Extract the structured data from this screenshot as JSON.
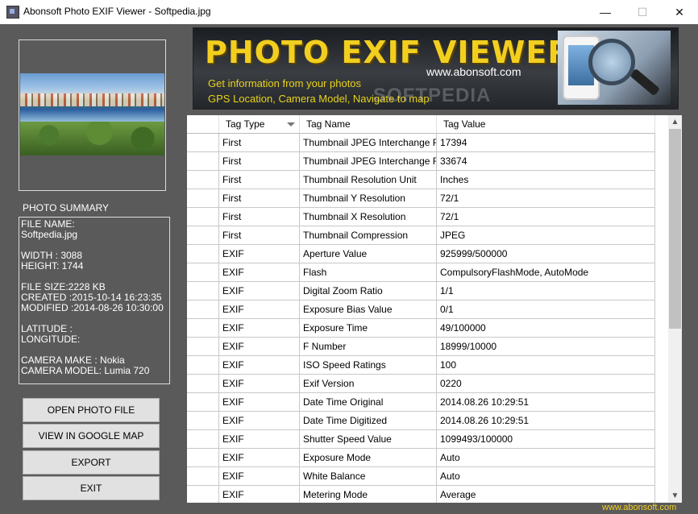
{
  "window": {
    "title": "Abonsoft Photo EXIF Viewer - Softpedia.jpg",
    "min": "—",
    "max": "☐",
    "close": "✕"
  },
  "banner": {
    "title": "PHOTO EXIF VIEWER",
    "url": "www.abonsoft.com",
    "line1": "Get information from your photos",
    "line2": "GPS Location, Camera Model, Navigate to map",
    "watermark": "SOFTPEDIA"
  },
  "summary": {
    "heading": "PHOTO SUMMARY",
    "lines": [
      "FILE NAME:",
      "Softpedia.jpg",
      "",
      "WIDTH : 3088",
      "HEIGHT: 1744",
      "",
      "FILE SIZE:2228 KB",
      "CREATED  :2015-10-14 16:23:35",
      "MODIFIED :2014-08-26 10:30:00",
      "",
      "LATITUDE :",
      "LONGITUDE:",
      "",
      "CAMERA MAKE : Nokia",
      "CAMERA MODEL: Lumia 720"
    ]
  },
  "buttons": {
    "open": "OPEN PHOTO FILE",
    "map": "VIEW IN GOOGLE MAP",
    "export": "EXPORT",
    "exit": "EXIT"
  },
  "table": {
    "headers": [
      "Tag Type",
      "Tag Name",
      "Tag Value"
    ],
    "rows": [
      [
        "First",
        "Thumbnail JPEG Interchange F...",
        "17394"
      ],
      [
        "First",
        "Thumbnail JPEG Interchange F...",
        "33674"
      ],
      [
        "First",
        "Thumbnail Resolution Unit",
        "Inches"
      ],
      [
        "First",
        "Thumbnail Y Resolution",
        "72/1"
      ],
      [
        "First",
        "Thumbnail X Resolution",
        "72/1"
      ],
      [
        "First",
        "Thumbnail Compression",
        "JPEG"
      ],
      [
        "EXIF",
        "Aperture Value",
        "925999/500000"
      ],
      [
        "EXIF",
        "Flash",
        "CompulsoryFlashMode, AutoMode"
      ],
      [
        "EXIF",
        "Digital Zoom Ratio",
        "1/1"
      ],
      [
        "EXIF",
        "Exposure Bias Value",
        "0/1"
      ],
      [
        "EXIF",
        "Exposure Time",
        "49/100000"
      ],
      [
        "EXIF",
        "F Number",
        "18999/10000"
      ],
      [
        "EXIF",
        "ISO Speed Ratings",
        "100"
      ],
      [
        "EXIF",
        "Exif Version",
        "0220"
      ],
      [
        "EXIF",
        "Date Time Original",
        "2014.08.26 10:29:51"
      ],
      [
        "EXIF",
        "Date Time Digitized",
        "2014.08.26 10:29:51"
      ],
      [
        "EXIF",
        "Shutter Speed Value",
        "1099493/100000"
      ],
      [
        "EXIF",
        "Exposure Mode",
        "Auto"
      ],
      [
        "EXIF",
        "White Balance",
        "Auto"
      ],
      [
        "EXIF",
        "Metering Mode",
        "Average"
      ]
    ]
  },
  "scroll": {
    "up": "▲",
    "down": "▼"
  },
  "footer": {
    "url": "www.abonsoft.com"
  }
}
